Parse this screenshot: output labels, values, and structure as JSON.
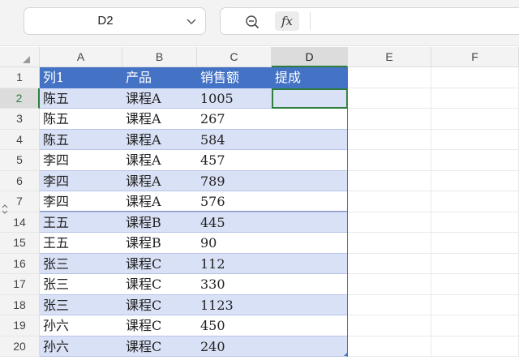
{
  "formula_bar": {
    "name_box": "D2",
    "formula_content": "",
    "fx_label": "fx"
  },
  "columns": [
    "A",
    "B",
    "C",
    "D",
    "E",
    "F"
  ],
  "selected_cell": "D2",
  "table": {
    "headers": [
      "列1",
      "产品",
      "销售额",
      "提成"
    ],
    "rows": [
      {
        "row": "2",
        "cells": [
          "陈五",
          "课程A",
          "1005",
          ""
        ]
      },
      {
        "row": "3",
        "cells": [
          "陈五",
          "课程A",
          "267",
          ""
        ]
      },
      {
        "row": "4",
        "cells": [
          "陈五",
          "课程A",
          "584",
          ""
        ]
      },
      {
        "row": "5",
        "cells": [
          "李四",
          "课程A",
          "457",
          ""
        ]
      },
      {
        "row": "6",
        "cells": [
          "李四",
          "课程A",
          "789",
          ""
        ]
      },
      {
        "row": "7",
        "cells": [
          "李四",
          "课程A",
          "576",
          ""
        ]
      },
      {
        "row": "14",
        "cells": [
          "王五",
          "课程B",
          "445",
          ""
        ]
      },
      {
        "row": "15",
        "cells": [
          "王五",
          "课程B",
          "90",
          ""
        ]
      },
      {
        "row": "16",
        "cells": [
          "张三",
          "课程C",
          "112",
          ""
        ]
      },
      {
        "row": "17",
        "cells": [
          "张三",
          "课程C",
          "330",
          ""
        ]
      },
      {
        "row": "18",
        "cells": [
          "张三",
          "课程C",
          "1123",
          ""
        ]
      },
      {
        "row": "19",
        "cells": [
          "孙六",
          "课程C",
          "450",
          ""
        ]
      },
      {
        "row": "20",
        "cells": [
          "孙六",
          "课程C",
          "240",
          ""
        ]
      }
    ],
    "header_row": "1"
  },
  "colors": {
    "header_fill": "#4472c4",
    "band_fill": "#d9e1f6",
    "selection": "#2f7d3c"
  }
}
